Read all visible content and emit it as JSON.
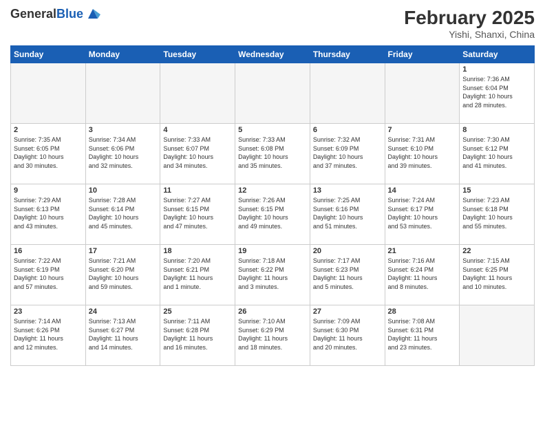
{
  "header": {
    "logo_line1": "General",
    "logo_line2": "Blue",
    "month_title": "February 2025",
    "location": "Yishi, Shanxi, China"
  },
  "weekdays": [
    "Sunday",
    "Monday",
    "Tuesday",
    "Wednesday",
    "Thursday",
    "Friday",
    "Saturday"
  ],
  "weeks": [
    [
      {
        "day": "",
        "info": ""
      },
      {
        "day": "",
        "info": ""
      },
      {
        "day": "",
        "info": ""
      },
      {
        "day": "",
        "info": ""
      },
      {
        "day": "",
        "info": ""
      },
      {
        "day": "",
        "info": ""
      },
      {
        "day": "1",
        "info": "Sunrise: 7:36 AM\nSunset: 6:04 PM\nDaylight: 10 hours\nand 28 minutes."
      }
    ],
    [
      {
        "day": "2",
        "info": "Sunrise: 7:35 AM\nSunset: 6:05 PM\nDaylight: 10 hours\nand 30 minutes."
      },
      {
        "day": "3",
        "info": "Sunrise: 7:34 AM\nSunset: 6:06 PM\nDaylight: 10 hours\nand 32 minutes."
      },
      {
        "day": "4",
        "info": "Sunrise: 7:33 AM\nSunset: 6:07 PM\nDaylight: 10 hours\nand 34 minutes."
      },
      {
        "day": "5",
        "info": "Sunrise: 7:33 AM\nSunset: 6:08 PM\nDaylight: 10 hours\nand 35 minutes."
      },
      {
        "day": "6",
        "info": "Sunrise: 7:32 AM\nSunset: 6:09 PM\nDaylight: 10 hours\nand 37 minutes."
      },
      {
        "day": "7",
        "info": "Sunrise: 7:31 AM\nSunset: 6:10 PM\nDaylight: 10 hours\nand 39 minutes."
      },
      {
        "day": "8",
        "info": "Sunrise: 7:30 AM\nSunset: 6:12 PM\nDaylight: 10 hours\nand 41 minutes."
      }
    ],
    [
      {
        "day": "9",
        "info": "Sunrise: 7:29 AM\nSunset: 6:13 PM\nDaylight: 10 hours\nand 43 minutes."
      },
      {
        "day": "10",
        "info": "Sunrise: 7:28 AM\nSunset: 6:14 PM\nDaylight: 10 hours\nand 45 minutes."
      },
      {
        "day": "11",
        "info": "Sunrise: 7:27 AM\nSunset: 6:15 PM\nDaylight: 10 hours\nand 47 minutes."
      },
      {
        "day": "12",
        "info": "Sunrise: 7:26 AM\nSunset: 6:15 PM\nDaylight: 10 hours\nand 49 minutes."
      },
      {
        "day": "13",
        "info": "Sunrise: 7:25 AM\nSunset: 6:16 PM\nDaylight: 10 hours\nand 51 minutes."
      },
      {
        "day": "14",
        "info": "Sunrise: 7:24 AM\nSunset: 6:17 PM\nDaylight: 10 hours\nand 53 minutes."
      },
      {
        "day": "15",
        "info": "Sunrise: 7:23 AM\nSunset: 6:18 PM\nDaylight: 10 hours\nand 55 minutes."
      }
    ],
    [
      {
        "day": "16",
        "info": "Sunrise: 7:22 AM\nSunset: 6:19 PM\nDaylight: 10 hours\nand 57 minutes."
      },
      {
        "day": "17",
        "info": "Sunrise: 7:21 AM\nSunset: 6:20 PM\nDaylight: 10 hours\nand 59 minutes."
      },
      {
        "day": "18",
        "info": "Sunrise: 7:20 AM\nSunset: 6:21 PM\nDaylight: 11 hours\nand 1 minute."
      },
      {
        "day": "19",
        "info": "Sunrise: 7:18 AM\nSunset: 6:22 PM\nDaylight: 11 hours\nand 3 minutes."
      },
      {
        "day": "20",
        "info": "Sunrise: 7:17 AM\nSunset: 6:23 PM\nDaylight: 11 hours\nand 5 minutes."
      },
      {
        "day": "21",
        "info": "Sunrise: 7:16 AM\nSunset: 6:24 PM\nDaylight: 11 hours\nand 8 minutes."
      },
      {
        "day": "22",
        "info": "Sunrise: 7:15 AM\nSunset: 6:25 PM\nDaylight: 11 hours\nand 10 minutes."
      }
    ],
    [
      {
        "day": "23",
        "info": "Sunrise: 7:14 AM\nSunset: 6:26 PM\nDaylight: 11 hours\nand 12 minutes."
      },
      {
        "day": "24",
        "info": "Sunrise: 7:13 AM\nSunset: 6:27 PM\nDaylight: 11 hours\nand 14 minutes."
      },
      {
        "day": "25",
        "info": "Sunrise: 7:11 AM\nSunset: 6:28 PM\nDaylight: 11 hours\nand 16 minutes."
      },
      {
        "day": "26",
        "info": "Sunrise: 7:10 AM\nSunset: 6:29 PM\nDaylight: 11 hours\nand 18 minutes."
      },
      {
        "day": "27",
        "info": "Sunrise: 7:09 AM\nSunset: 6:30 PM\nDaylight: 11 hours\nand 20 minutes."
      },
      {
        "day": "28",
        "info": "Sunrise: 7:08 AM\nSunset: 6:31 PM\nDaylight: 11 hours\nand 23 minutes."
      },
      {
        "day": "",
        "info": ""
      }
    ]
  ]
}
